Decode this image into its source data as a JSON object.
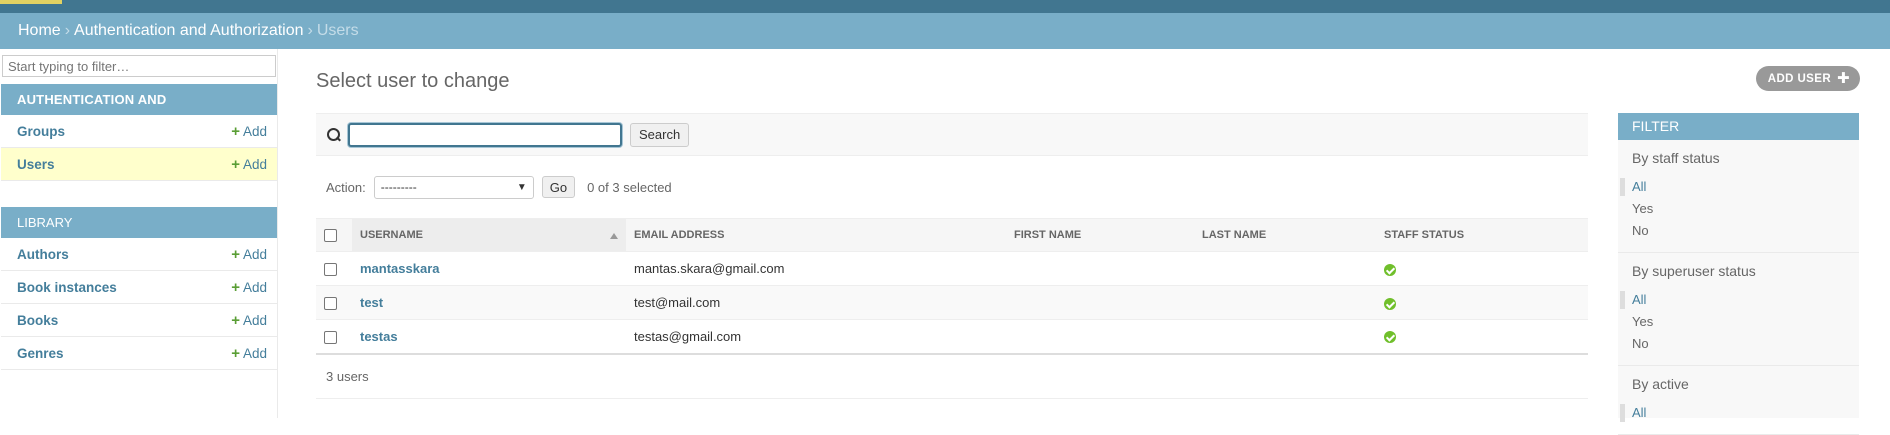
{
  "breadcrumbs": {
    "home": "Home",
    "section": "Authentication and Authorization",
    "current": "Users",
    "separator": "›"
  },
  "sidebar": {
    "filter_placeholder": "Start typing to filter…",
    "modules": [
      {
        "caption": "Authentication and Authorization",
        "rows": [
          {
            "name": "Groups",
            "add": "Add"
          },
          {
            "name": "Users",
            "add": "Add"
          }
        ]
      },
      {
        "caption": "Library",
        "rows": [
          {
            "name": "Authors",
            "add": "Add"
          },
          {
            "name": "Book instances",
            "add": "Add"
          },
          {
            "name": "Books",
            "add": "Add"
          },
          {
            "name": "Genres",
            "add": "Add"
          }
        ]
      }
    ]
  },
  "content": {
    "title": "Select user to change",
    "add_button": "ADD USER",
    "search_button": "Search",
    "search_value": "",
    "action_label": "Action:",
    "action_selected": "---------",
    "go_button": "Go",
    "selected_count": "0 of 3 selected",
    "columns": [
      "Username",
      "Email address",
      "First name",
      "Last name",
      "Staff status"
    ],
    "rows": [
      {
        "username": "mantasskara",
        "email": "mantas.skara@gmail.com",
        "first": "",
        "last": "",
        "staff": "yes"
      },
      {
        "username": "test",
        "email": "test@mail.com",
        "first": "",
        "last": "",
        "staff": "yes"
      },
      {
        "username": "testas",
        "email": "testas@gmail.com",
        "first": "",
        "last": "",
        "staff": "yes"
      }
    ],
    "paginator": "3 users"
  },
  "filter": {
    "caption": "Filter",
    "groups": [
      {
        "title": "By staff status",
        "options": [
          "All",
          "Yes",
          "No"
        ]
      },
      {
        "title": "By superuser status",
        "options": [
          "All",
          "Yes",
          "No"
        ]
      },
      {
        "title": "By active",
        "options": [
          "All"
        ]
      }
    ]
  },
  "colors": {
    "header": "#417690",
    "breadcrumb": "#79aec8",
    "link": "#447e9b",
    "selected_row": "#ffffcc",
    "success": "#70bf2b"
  }
}
